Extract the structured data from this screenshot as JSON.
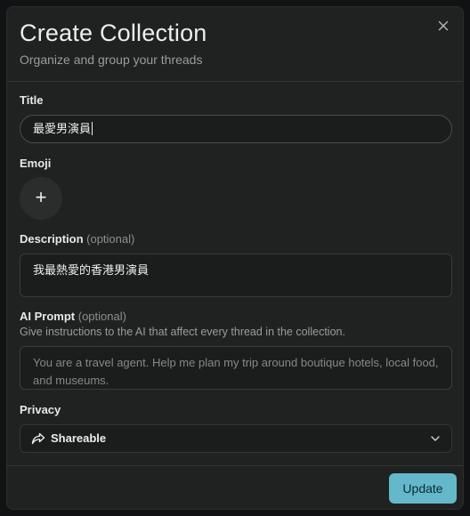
{
  "modal": {
    "title": "Create Collection",
    "subtitle": "Organize and group your threads",
    "close_icon": "close-icon"
  },
  "fields": {
    "title": {
      "label": "Title",
      "value": "最愛男演員"
    },
    "emoji": {
      "label": "Emoji",
      "button_icon": "plus-icon",
      "button_glyph": "+"
    },
    "description": {
      "label": "Description",
      "optional": "(optional)",
      "value": "我最熱愛的香港男演員"
    },
    "ai_prompt": {
      "label": "AI Prompt",
      "optional": "(optional)",
      "help": "Give instructions to the AI that affect every thread in the collection.",
      "placeholder": "You are a travel agent. Help me plan my trip around boutique hotels, local food, and museums."
    },
    "privacy": {
      "label": "Privacy",
      "value": "Shareable",
      "icon": "share-icon",
      "chevron": "chevron-down-icon"
    }
  },
  "footer": {
    "update_label": "Update"
  },
  "colors": {
    "accent": "#64b8c9",
    "modal_bg": "#202222",
    "input_bg": "#1b1d1d"
  }
}
